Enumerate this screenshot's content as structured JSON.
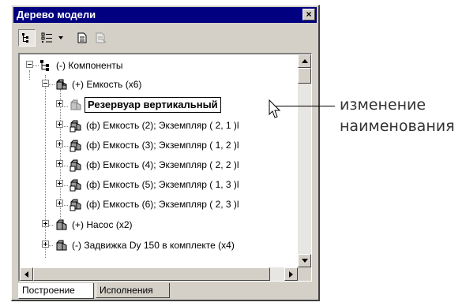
{
  "window": {
    "title": "Дерево модели",
    "close_label": "×"
  },
  "toolbar": {
    "icons": [
      "tree-structure-icon",
      "list-view-icon",
      "dropdown-arrow-icon",
      "page-icon",
      "page-disabled-icon"
    ]
  },
  "tree": {
    "root": "(-) Компоненты",
    "group": "(+) Емкость (x6)",
    "editing_label": "Резервуар вертикальный",
    "children": [
      "(ф) Емкость (2); Экземпляр ( 2, 1 )l",
      "(ф) Емкость (3); Экземпляр ( 1, 2 )l",
      "(ф) Емкость (4); Экземпляр ( 2, 2 )l",
      "(ф) Емкость (5); Экземпляр ( 1, 3 )l",
      "(ф) Емкость (6); Экземпляр ( 2, 3 )l"
    ],
    "siblings": [
      "(+) Насос (x2)",
      "(-) Задвижка Dy 150 в комплекте (x4)"
    ]
  },
  "tabs": [
    "Построение",
    "Исполнения"
  ],
  "callout": {
    "line1": "изменение",
    "line2": "наименования"
  },
  "colors": {
    "titlebar": "#000080",
    "panel": "#d4d0c8"
  }
}
